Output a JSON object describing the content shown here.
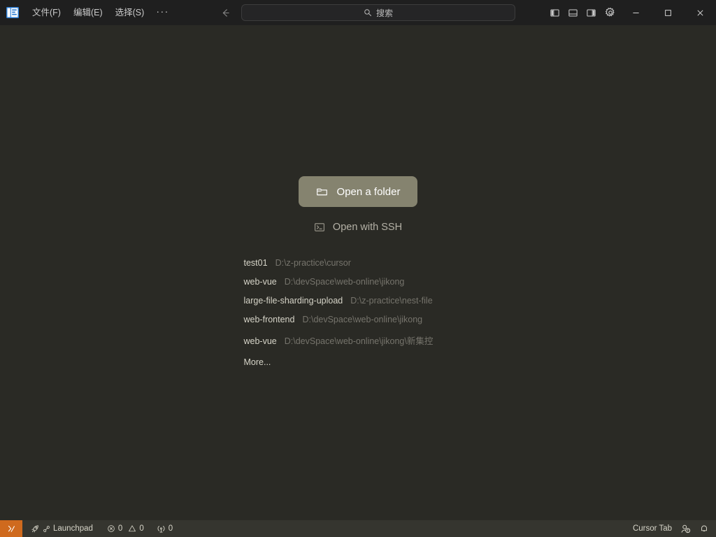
{
  "titlebar": {
    "app_icon": "app-logo-icon",
    "menus": [
      {
        "label": "文件(F)",
        "name": "menu-file"
      },
      {
        "label": "编辑(E)",
        "name": "menu-edit"
      },
      {
        "label": "选择(S)",
        "name": "menu-selection"
      }
    ],
    "more_label": "···",
    "nav": {
      "back": "arrow-left-icon",
      "forward": "arrow-right-icon"
    },
    "search": {
      "placeholder": "搜索",
      "icon": "search-icon"
    },
    "layout_controls": [
      {
        "name": "toggle-primary-sidebar",
        "icon": "layout-sidebar-left-icon"
      },
      {
        "name": "toggle-panel",
        "icon": "layout-panel-bottom-icon"
      },
      {
        "name": "toggle-secondary-sidebar",
        "icon": "layout-sidebar-right-icon"
      },
      {
        "name": "manage-settings",
        "icon": "gear-icon"
      }
    ],
    "window_controls": [
      {
        "name": "minimize-button",
        "icon": "minimize-icon"
      },
      {
        "name": "maximize-button",
        "icon": "maximize-icon"
      },
      {
        "name": "close-button",
        "icon": "close-icon"
      }
    ]
  },
  "welcome": {
    "open_folder_label": "Open a folder",
    "open_folder_icon": "folder-icon",
    "ssh_label": "Open with SSH",
    "ssh_icon": "terminal-icon",
    "recents": [
      {
        "name": "test01",
        "path": "D:\\z-practice\\cursor"
      },
      {
        "name": "web-vue",
        "path": "D:\\devSpace\\web-online\\jikong"
      },
      {
        "name": "large-file-sharding-upload",
        "path": "D:\\z-practice\\nest-file"
      },
      {
        "name": "web-frontend",
        "path": "D:\\devSpace\\web-online\\jikong"
      },
      {
        "name": "web-vue",
        "path": "D:\\devSpace\\web-online\\jikong\\新集控"
      }
    ],
    "more_label": "More..."
  },
  "statusbar": {
    "remote_icon": "remote-window-icon",
    "launchpad_label": "Launchpad",
    "launchpad_icon": "rocket-icon",
    "link_icon": "link-icon",
    "errors_count": "0",
    "errors_icon": "error-circle-icon",
    "warnings_count": "0",
    "warnings_icon": "warning-triangle-icon",
    "ports_count": "0",
    "ports_icon": "radio-tower-icon",
    "cursor_tab_label": "Cursor Tab",
    "account_icon": "account-icon",
    "bell_icon": "bell-icon"
  },
  "colors": {
    "titlebar_bg": "#1f1f1f",
    "editor_bg": "#2a2a25",
    "statusbar_bg": "#35352f",
    "remote_accent": "#cf6a1e",
    "button_bg": "#85836f",
    "muted_text": "#76746c"
  }
}
